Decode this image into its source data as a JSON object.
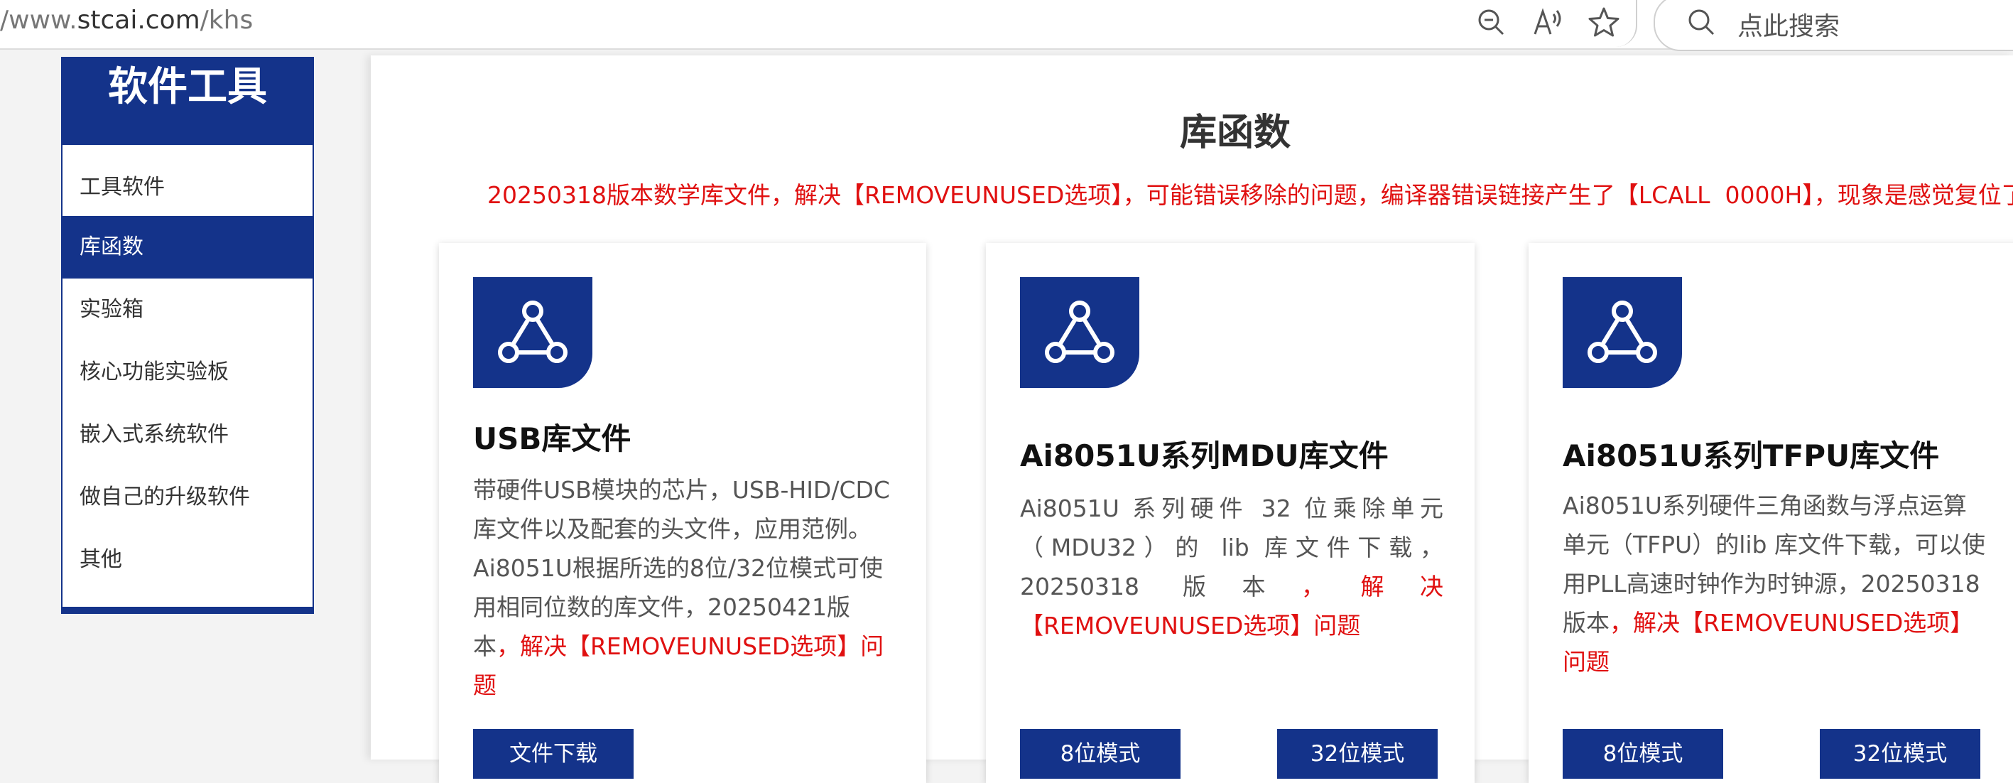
{
  "browser": {
    "url_prefix": "/www.",
    "url_domain": "stcai.com",
    "url_path": "/khs",
    "search_placeholder": "点此搜索"
  },
  "sidebar": {
    "title": "软件工具",
    "items": [
      {
        "label": "工具软件",
        "active": false
      },
      {
        "label": "库函数",
        "active": true
      },
      {
        "label": "实验箱",
        "active": false
      },
      {
        "label": "核心功能实验板",
        "active": false
      },
      {
        "label": "嵌入式系统软件",
        "active": false
      },
      {
        "label": "做自己的升级软件",
        "active": false
      },
      {
        "label": "其他",
        "active": false
      }
    ]
  },
  "main": {
    "title": "库函数",
    "notice": "20250318版本数学库文件，解决【REMOVEUNUSED选项】，可能错误移除的问题，编译器错误链接产生了【LCALL  0000H】，现象是感觉复位了"
  },
  "cards": [
    {
      "title": "USB库文件",
      "desc": "带硬件USB模块的芯片，USB-HID/CDC库文件以及配套的头文件，应用范例。Ai8051U根据所选的8位/32位模式可使用相同位数的库文件，20250421版本",
      "desc_red": "，解决【REMOVEUNUSED选项】问题",
      "buttons": [
        "文件下载"
      ]
    },
    {
      "title": "Ai8051U系列MDU库文件",
      "desc": "Ai8051U 系列硬件 32 位乘除单元（MDU32）的 lib 库文件下载，20250318 版本",
      "desc_red": "，解决【REMOVEUNUSED选项】问题",
      "buttons": [
        "8位模式",
        "32位模式"
      ]
    },
    {
      "title": "Ai8051U系列TFPU库文件",
      "desc": "Ai8051U系列硬件三角函数与浮点运算单元（TFPU）的lib 库文件下载，可以使用PLL高速时钟作为时钟源，20250318版本",
      "desc_red": "，解决【REMOVEUNUSED选项】问题",
      "buttons": [
        "8位模式",
        "32位模式"
      ]
    }
  ],
  "colors": {
    "brand_blue": "#14338a",
    "alert_red": "#e01010"
  },
  "icons": [
    "zoom-out-icon",
    "read-aloud-icon",
    "favorite-star-icon",
    "search-icon",
    "share-nodes-icon"
  ]
}
